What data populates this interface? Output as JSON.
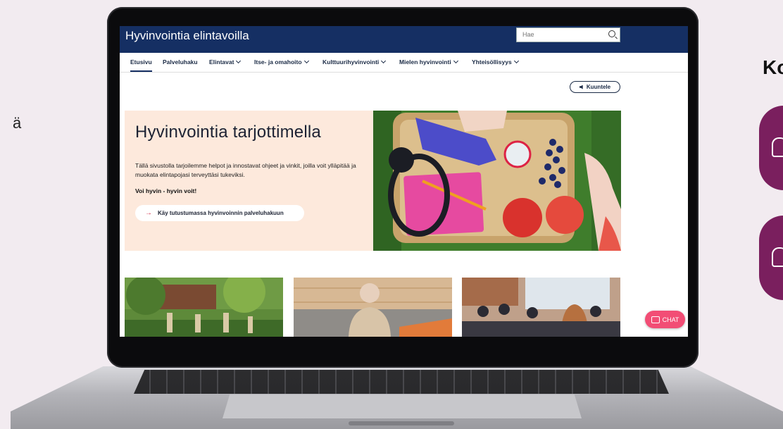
{
  "edge_left_text": "ä",
  "edge_right_text": "Ko",
  "site": {
    "title": "Hyvinvointia elintavoilla",
    "search_placeholder": "Hae"
  },
  "nav": {
    "items": [
      {
        "label": "Etusivu",
        "active": true,
        "dropdown": false
      },
      {
        "label": "Palveluhaku",
        "active": false,
        "dropdown": false
      },
      {
        "label": "Elintavat",
        "active": false,
        "dropdown": true
      },
      {
        "label": "Itse- ja omahoito",
        "active": false,
        "dropdown": true
      },
      {
        "label": "Kulttuurihyvinvointi",
        "active": false,
        "dropdown": true
      },
      {
        "label": "Mielen hyvinvointi",
        "active": false,
        "dropdown": true
      },
      {
        "label": "Yhteisöllisyys",
        "active": false,
        "dropdown": true
      }
    ]
  },
  "listen_label": "Kuuntele",
  "hero": {
    "title": "Hyvinvointia tarjottimella",
    "body": "Tällä sivustolla tarjoilemme helpot ja innostavat ohjeet ja vinkit, joilla voit ylläpitää ja muokata elintapojasi terveyttäsi tukeviksi.",
    "strong": "Voi hyvin - hyvin voit!",
    "cta_label": "Käy tutustumassa hyvinvoinnin palveluhakuun"
  },
  "chat_label": "CHAT",
  "colors": {
    "header_bg": "#152f63",
    "hero_bg": "#fde9dc",
    "chat_bg": "#f24d75",
    "accent_circle": "#7a1f5e"
  }
}
